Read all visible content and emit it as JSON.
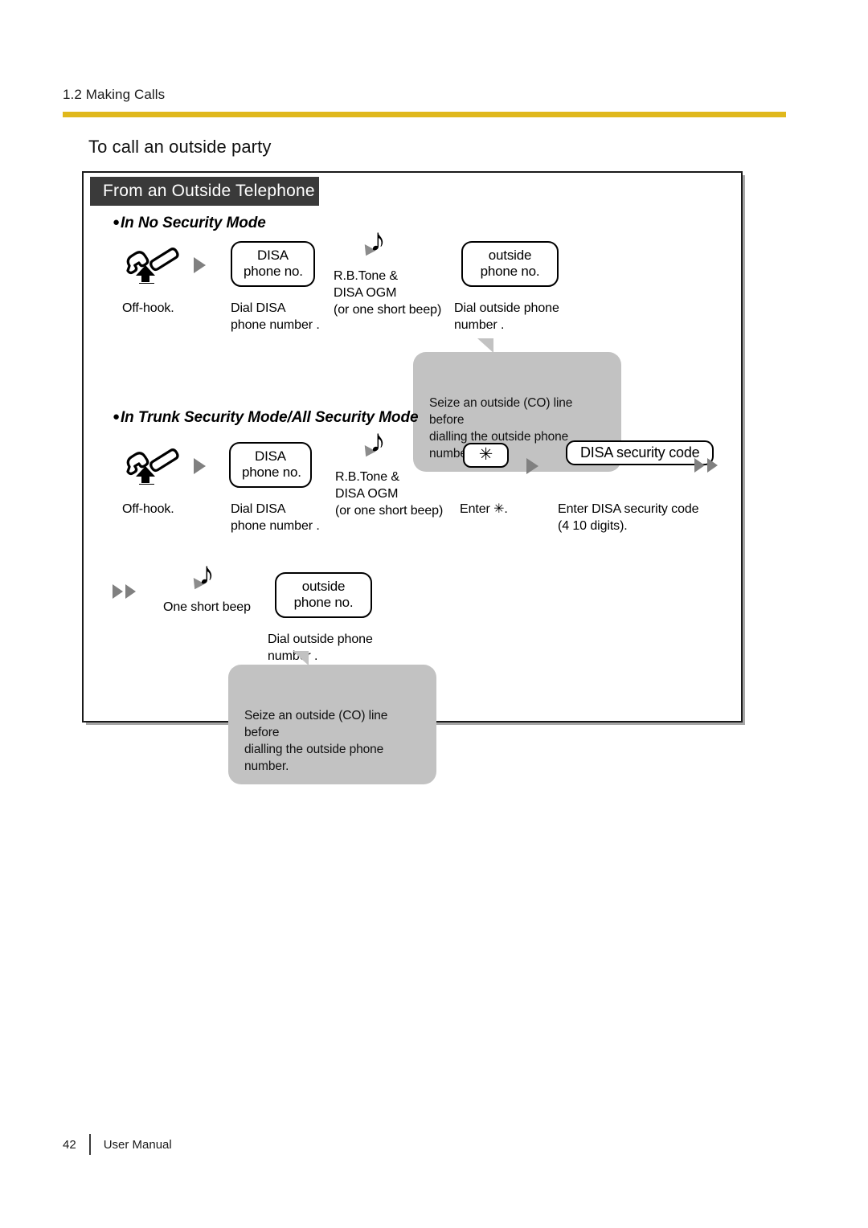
{
  "header": {
    "running_head": "1.2 Making Calls",
    "rule_color": "#E0B81C"
  },
  "page_title": "To call an outside party",
  "frame": {
    "banner": "From an Outside Telephone",
    "banner_bg": "#3A3A3A"
  },
  "sections": [
    {
      "bullet": "●",
      "heading": "In No Security Mode",
      "steps": [
        {
          "icon": "offhook-handset-icon",
          "caption": "Off-hook."
        },
        {
          "arrow": "arrow-right"
        },
        {
          "box_line1": "DISA",
          "box_line2": "phone no.",
          "caption": "Dial DISA\nphone number  ."
        },
        {
          "tone_label": "R.B.Tone &\nDISA OGM\n(or one short beep)"
        },
        {
          "box_line1": "outside",
          "box_line2": "phone no.",
          "caption": "Dial outside phone\nnumber  ."
        }
      ],
      "callout": "Seize an outside (CO) line before\ndialling the outside phone number."
    },
    {
      "bullet": "●",
      "heading": "In Trunk Security Mode/All Security Mode",
      "steps": [
        {
          "icon": "offhook-handset-icon",
          "caption": "Off-hook."
        },
        {
          "arrow": "arrow-right"
        },
        {
          "box_line1": "DISA",
          "box_line2": "phone no.",
          "caption": "Dial DISA\nphone number  ."
        },
        {
          "tone_label": "R.B.Tone &\nDISA OGM\n(or one short beep)"
        },
        {
          "star_key": "✳",
          "caption": "Enter ✳."
        },
        {
          "arrow": "arrow-right"
        },
        {
          "box_single": "DISA security code",
          "caption": "Enter DISA security code\n(4  10 digits)."
        },
        {
          "arrow_pair": "arrow-right-double"
        }
      ],
      "steps_row2": [
        {
          "arrow_pair": "arrow-right-double"
        },
        {
          "tone_label": "One short beep"
        },
        {
          "box_line1": "outside",
          "box_line2": "phone no.",
          "caption": "Dial outside phone\nnumber  ."
        }
      ],
      "callout": "Seize an outside (CO) line before\ndialling the outside phone number."
    }
  ],
  "footer": {
    "page_number": "42",
    "document_name": "User Manual"
  }
}
